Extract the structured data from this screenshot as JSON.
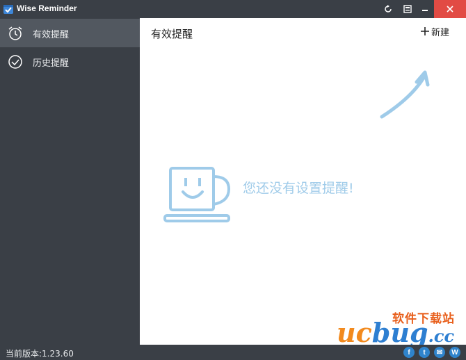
{
  "window": {
    "title": "Wise Reminder"
  },
  "sidebar": {
    "items": [
      {
        "label": "有效提醒",
        "icon": "alarm-clock-icon",
        "active": true
      },
      {
        "label": "历史提醒",
        "icon": "check-circle-icon",
        "active": false
      }
    ]
  },
  "main": {
    "title": "有效提醒",
    "new_label": "新建",
    "empty_message": "您还没有设置提醒!"
  },
  "footer": {
    "version": "当前版本:1.23.60",
    "social": [
      "f",
      "t",
      "✉",
      "W"
    ]
  },
  "watermark": {
    "top": "软件下载站",
    "uc": "uc",
    "bug": "bug",
    "cc": ".cc"
  },
  "colors": {
    "sidebar_bg": "#3a3f46",
    "active_item": "#525860",
    "close_button": "#e24b44",
    "empty_accent": "#9fcbe9",
    "social_blue": "#2f84cc"
  }
}
